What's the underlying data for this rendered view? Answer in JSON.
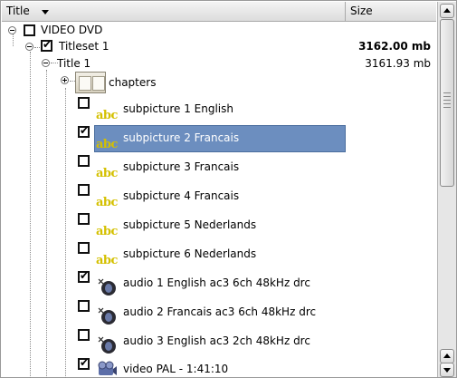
{
  "header": {
    "title_col": "Title",
    "size_col": "Size"
  },
  "tree": {
    "root": {
      "label": "VIDEO DVD",
      "checked": false
    },
    "titleset": {
      "label": "Titleset 1",
      "size": "3162.00 mb",
      "checked": true
    },
    "title": {
      "label": "Title 1",
      "size": "3161.93 mb"
    },
    "chapters": {
      "label": "chapters"
    },
    "items": [
      {
        "label": "subpicture 1 English",
        "kind": "subpicture",
        "checked": false
      },
      {
        "label": "subpicture 2 Francais",
        "kind": "subpicture",
        "checked": true,
        "selected": true
      },
      {
        "label": "subpicture 3 Francais",
        "kind": "subpicture",
        "checked": false
      },
      {
        "label": "subpicture 4 Francais",
        "kind": "subpicture",
        "checked": false
      },
      {
        "label": "subpicture 5 Nederlands",
        "kind": "subpicture",
        "checked": false
      },
      {
        "label": "subpicture 6 Nederlands",
        "kind": "subpicture",
        "checked": false
      },
      {
        "label": "audio 1 English ac3  6ch 48kHz  drc",
        "kind": "audio",
        "checked": true
      },
      {
        "label": "audio 2 Francais ac3  6ch 48kHz  drc",
        "kind": "audio",
        "checked": false
      },
      {
        "label": "audio 3 English ac3  2ch 48kHz  drc",
        "kind": "audio",
        "checked": false
      },
      {
        "label": "video PAL  - 1:41:10",
        "kind": "video",
        "checked": true
      }
    ],
    "subpicture_icon_text": "abc",
    "icons": {
      "subpicture": "subtitle-abc-icon",
      "audio": "speaker-icon",
      "video": "film-reel-icon",
      "chapters": "book-icon"
    }
  },
  "colors": {
    "selection": "#6c8ebf",
    "abc_yellow": "#d4c000"
  }
}
